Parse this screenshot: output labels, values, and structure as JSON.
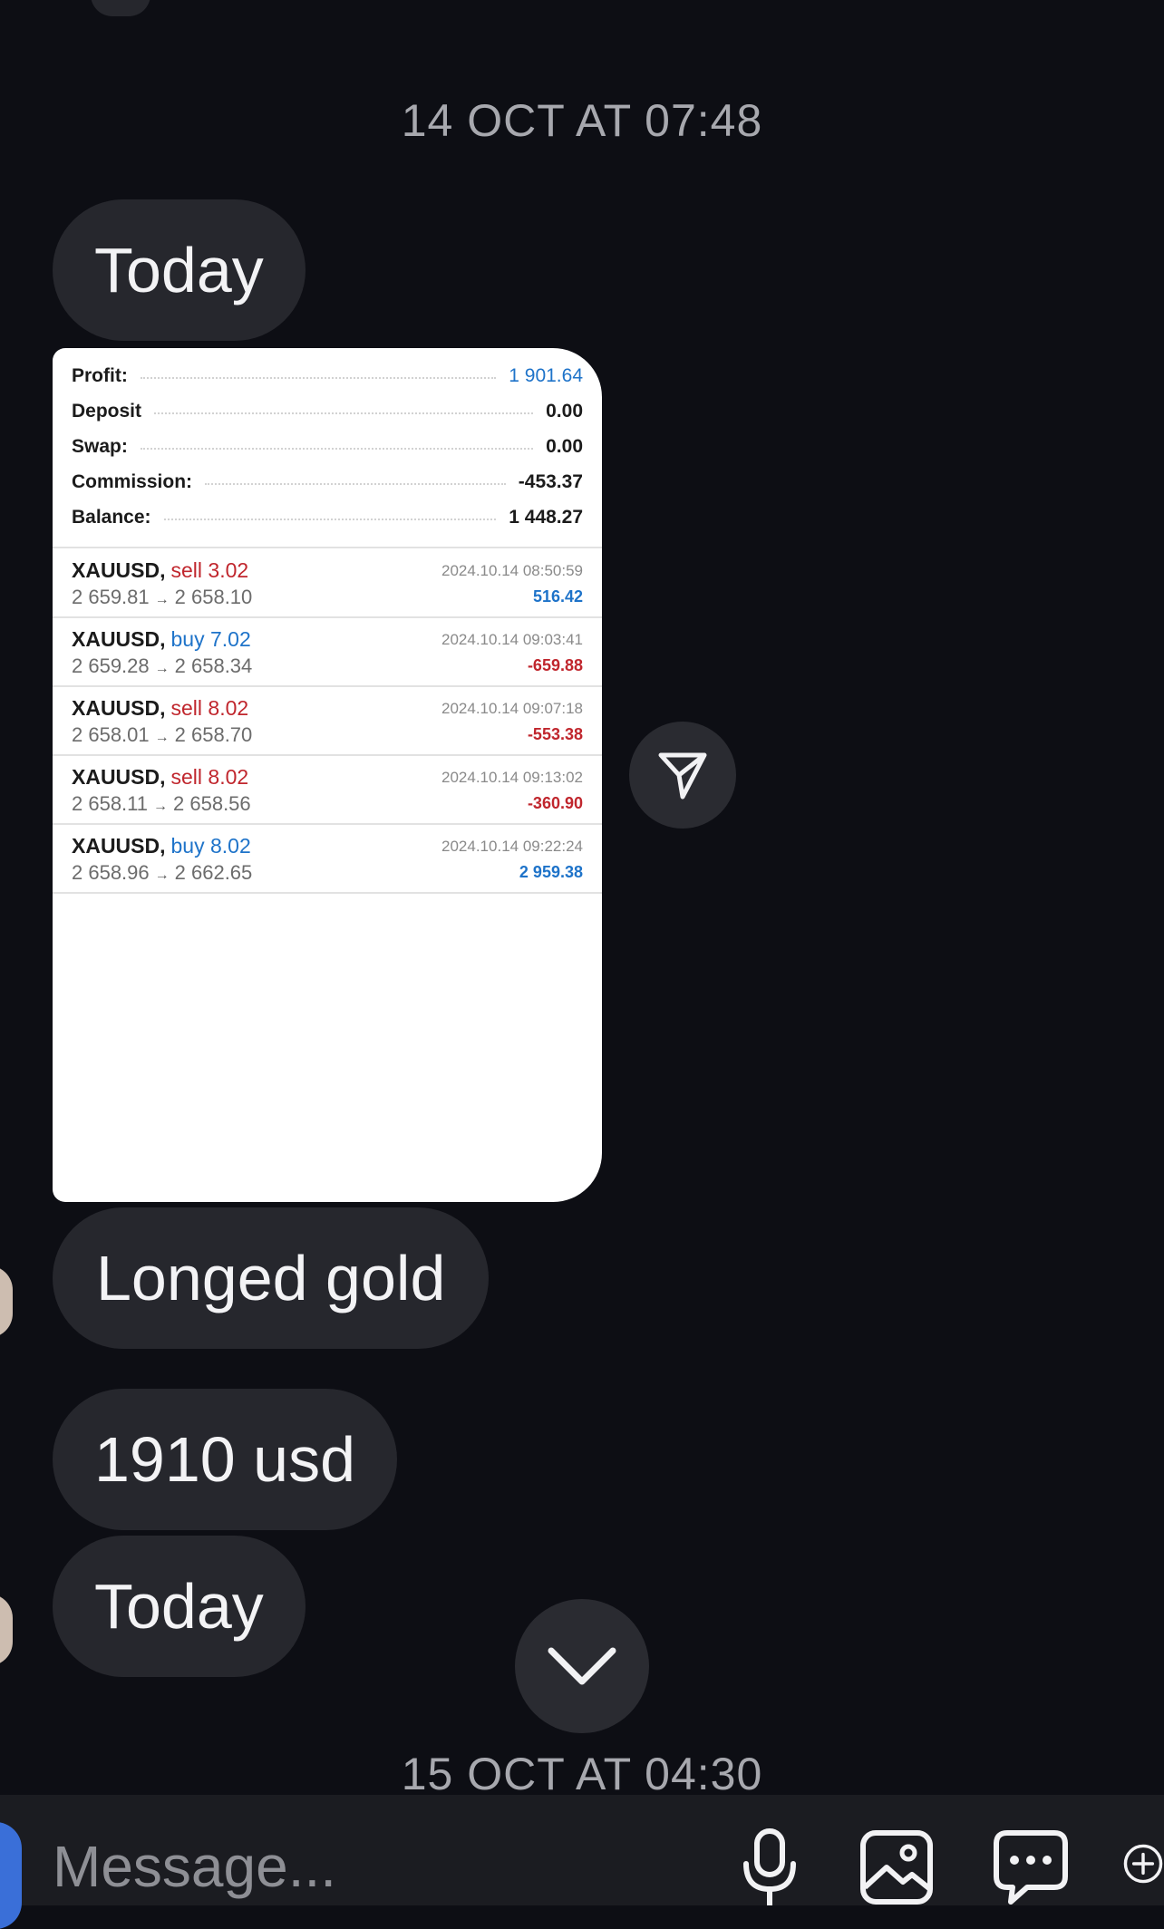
{
  "chat": {
    "date_1": "14 OCT AT 07:48",
    "date_2": "15 OCT AT 04:30",
    "messages": [
      "Today",
      "Longed gold",
      "1910 usd",
      "Today"
    ]
  },
  "screenshot": {
    "summary": [
      {
        "label": "Profit:",
        "value": "1 901.64",
        "color": "#1e73c9"
      },
      {
        "label": "Deposit",
        "value": "0.00",
        "color": "#1b1b1b"
      },
      {
        "label": "Swap:",
        "value": "0.00",
        "color": "#1b1b1b"
      },
      {
        "label": "Commission:",
        "value": "-453.37",
        "color": "#1b1b1b"
      },
      {
        "label": "Balance:",
        "value": "1 448.27",
        "color": "#1b1b1b"
      }
    ],
    "trades": [
      {
        "symbol": "XAUUSD,",
        "side": "sell 3.02",
        "open": "2 659.81",
        "arrow": "→",
        "close": "2 658.10",
        "time": "2024.10.14 08:50:59",
        "pl": "516.42"
      },
      {
        "symbol": "XAUUSD,",
        "side": "buy 7.02",
        "open": "2 659.28",
        "arrow": "→",
        "close": "2 658.34",
        "time": "2024.10.14 09:03:41",
        "pl": "-659.88"
      },
      {
        "symbol": "XAUUSD,",
        "side": "sell 8.02",
        "open": "2 658.01",
        "arrow": "→",
        "close": "2 658.70",
        "time": "2024.10.14 09:07:18",
        "pl": "-553.38"
      },
      {
        "symbol": "XAUUSD,",
        "side": "sell 8.02",
        "open": "2 658.11",
        "arrow": "→",
        "close": "2 658.56",
        "time": "2024.10.14 09:13:02",
        "pl": "-360.90"
      },
      {
        "symbol": "XAUUSD,",
        "side": "buy 8.02",
        "open": "2 658.96",
        "arrow": "→",
        "close": "2 662.65",
        "time": "2024.10.14 09:22:24",
        "pl": "2 959.38"
      }
    ]
  },
  "composer": {
    "placeholder": "Message...",
    "icons": [
      "microphone-icon",
      "image-icon",
      "sticker-chat-icon",
      "plus-icon"
    ]
  },
  "actions": {
    "share_icon": "paper-plane-icon",
    "scroll_icon": "chevron-down-icon"
  },
  "colors": {
    "background": "#0d0e14",
    "bubble": "#26272d",
    "profit_blue": "#1e73c9",
    "loss_red": "#c0262d"
  }
}
